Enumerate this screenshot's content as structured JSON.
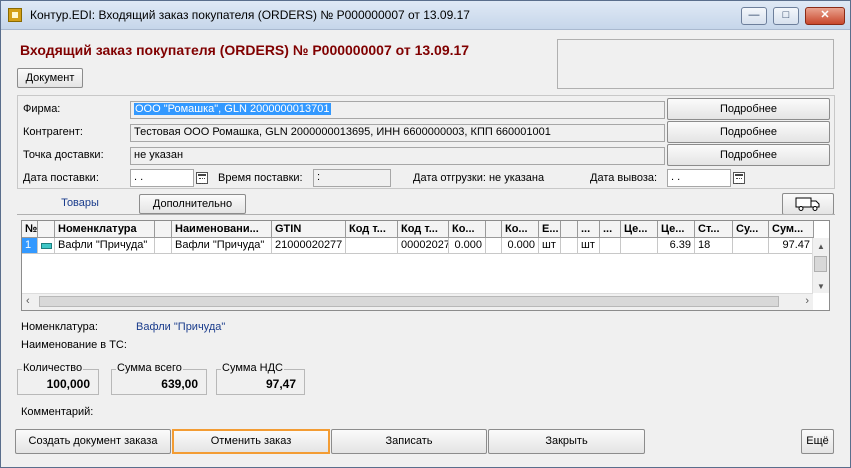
{
  "window": {
    "title": "Контур.EDI: Входящий заказ покупателя (ORDERS) № P000000007 от 13.09.17",
    "minimize_glyph": "—",
    "maximize_glyph": "□",
    "close_glyph": "✕"
  },
  "header": {
    "heading": "Входящий заказ покупателя (ORDERS) № P000000007 от 13.09.17",
    "heading_color": "#800000",
    "document_button": "Документ"
  },
  "form": {
    "firm": {
      "label": "Фирма:",
      "value": "ООО \"Ромашка\", GLN 2000000013701",
      "details": "Подробнее"
    },
    "counterparty": {
      "label": "Контрагент:",
      "value": "Тестовая ООО Ромашка, GLN 2000000013695, ИНН 6600000003, КПП 660001001",
      "details": "Подробнее"
    },
    "delivery_point": {
      "label": "Точка доставки:",
      "value": "не указан",
      "details": "Подробнее"
    },
    "delivery_date": {
      "label": "Дата поставки:",
      "value": " .  ."
    },
    "delivery_time": {
      "label": "Время поставки:",
      "value": ":"
    },
    "shipment_date": {
      "label": "Дата отгрузки: не указана"
    },
    "pickup_date": {
      "label": "Дата вывоза:",
      "value": " .  ."
    }
  },
  "tabs": {
    "goods": "Товары",
    "additional": "Дополнительно",
    "truck_icon": "truck-icon"
  },
  "table": {
    "headers": [
      "№",
      "",
      "Номенклатура",
      "",
      "Наименовани...",
      "GTIN",
      "Код т...",
      "Код т...",
      "Ко...",
      "",
      "Ко...",
      "Е...",
      "",
      "...",
      "...",
      "Це...",
      "Це...",
      "Ст...",
      "Су...",
      "Сум..."
    ],
    "row": [
      "1",
      "",
      "Вафли \"Причуда\"",
      "",
      "Вафли \"Причуда\"",
      "21000020277",
      "",
      "00002027",
      "0.000",
      "",
      "0.000",
      "шт",
      "",
      "шт",
      "",
      "",
      "6.39",
      "18",
      "",
      "97.47"
    ]
  },
  "details": {
    "nomenclature_label": "Номенклатура:",
    "nomenclature_value": "Вафли \"Причуда\"",
    "ts_name_label": "Наименование в ТС:"
  },
  "totals": {
    "quantity": {
      "label": "Количество",
      "value": "100,000"
    },
    "sum_total": {
      "label": "Сумма всего",
      "value": "639,00"
    },
    "sum_vat": {
      "label": "Сумма НДС",
      "value": "97,47"
    }
  },
  "comment_label": "Комментарий:",
  "footer": {
    "create_order": "Создать документ заказа",
    "cancel_order": "Отменить заказ",
    "save": "Записать",
    "close": "Закрыть",
    "more": "Ещё"
  },
  "colors": {
    "highlight_orange": "#f39c33",
    "selection_blue": "#3399ff",
    "link_blue": "#1a3c8c"
  }
}
